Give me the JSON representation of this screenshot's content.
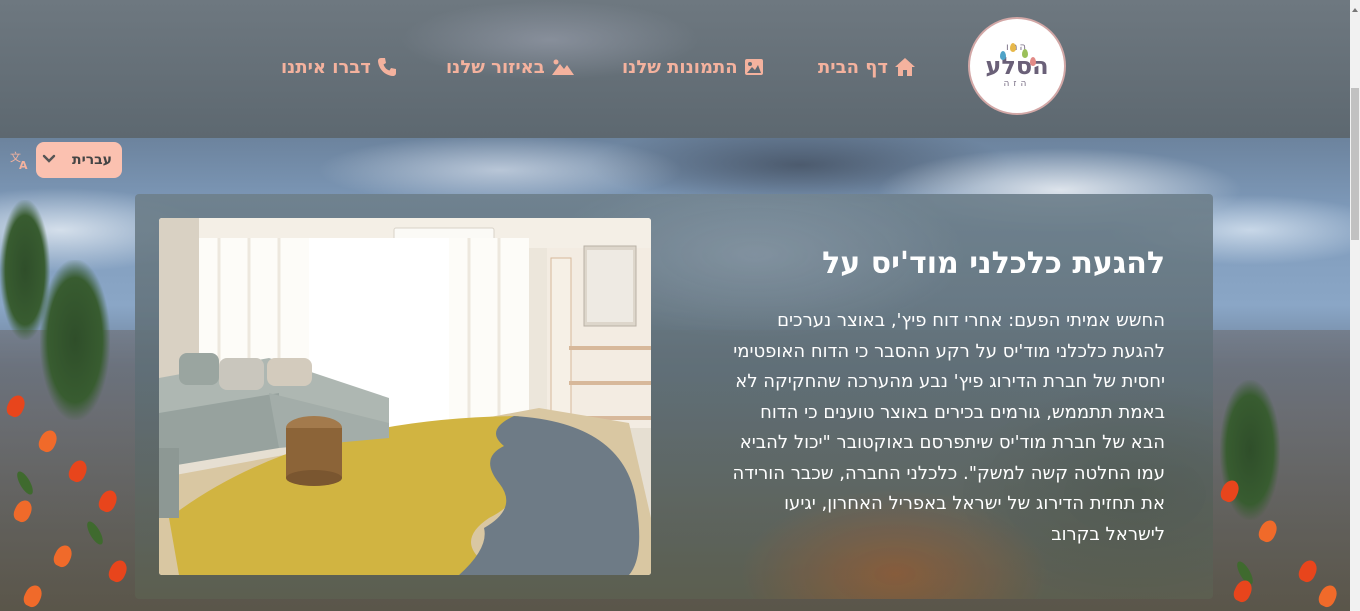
{
  "logo": {
    "top": "המו",
    "main": "הסלע",
    "bottom": "הזה"
  },
  "nav": {
    "home": "דף הבית",
    "photos": "התמונות שלנו",
    "area": "באיזור שלנו",
    "contact": "דברו איתנו"
  },
  "language": {
    "selected": "עברית"
  },
  "article": {
    "title": "להגעת כלכלני מוד'יס על",
    "body": "החשש אמיתי הפעם: אחרי דוח פיץ', באוצר נערכים להגעת כלכלני מוד'יס על רקע ההסבר כי הדוח האופטימי יחסית של חברת הדירוג פיץ' נבע מהערכה שהחקיקה לא באמת תתממש, גורמים בכירים באוצר טוענים כי הדוח הבא של חברת מוד'יס שיתפרסם באוקטובר \"יכול להביא עמו החלטה קשה למשק\". כלכלני החברה, שכבר הורידה את תחזית הדירוג של ישראל באפריל האחרון, יגיעו לישראל בקרוב"
  },
  "icons": {
    "home": "home-icon",
    "photos": "image-icon",
    "area": "mountain-icon",
    "contact": "phone-icon",
    "translate": "translate-icon",
    "dropdown": "chevron-down-icon"
  },
  "colors": {
    "nav_text": "#f4b29e",
    "lang_bg": "#fbc1b0",
    "header_bg": "#5f6a73",
    "logo_border": "#d2a7a6"
  }
}
